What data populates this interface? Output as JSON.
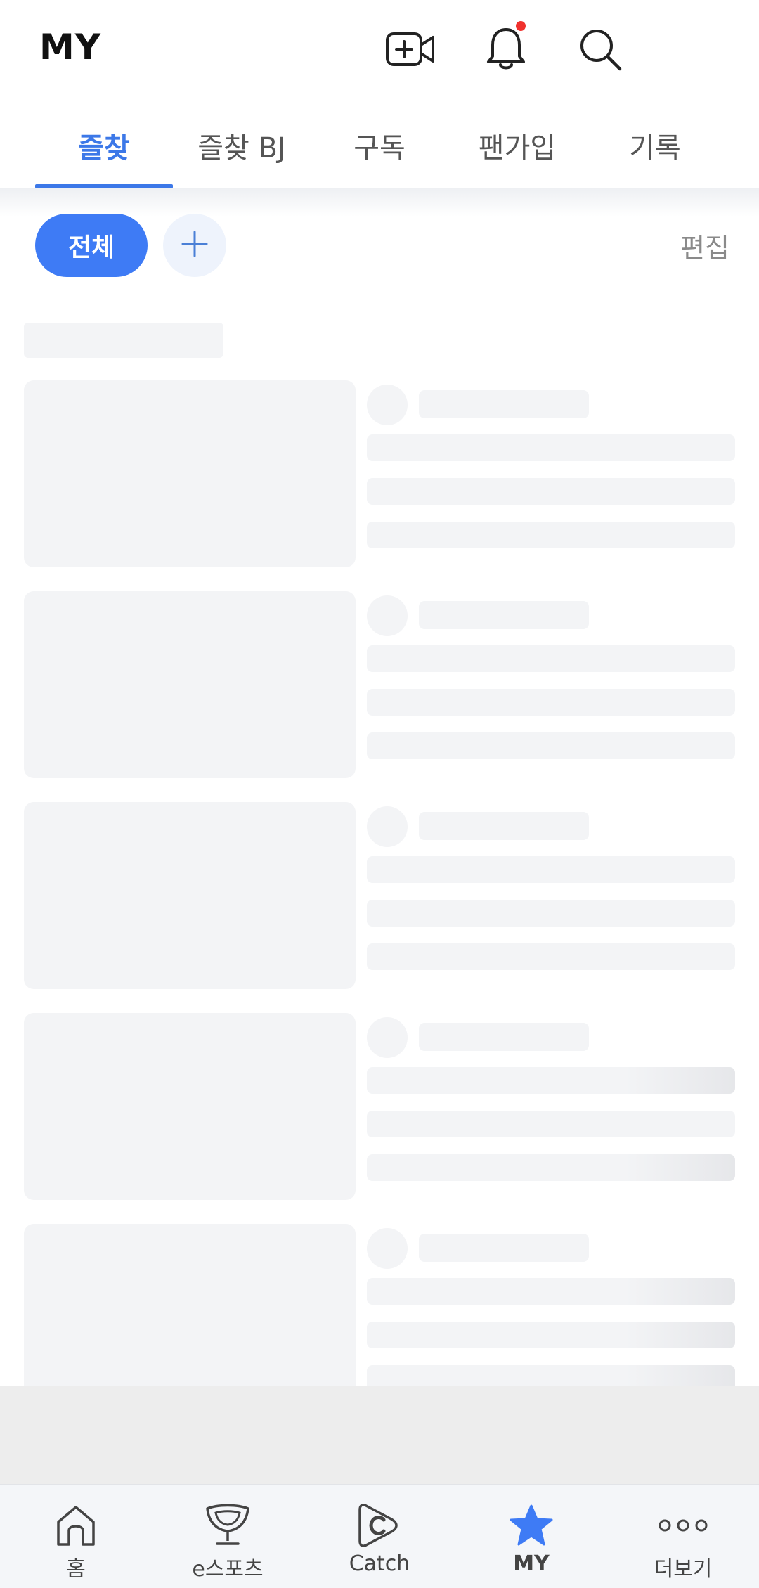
{
  "header": {
    "title": "MY",
    "icons": [
      "live-broadcast-icon",
      "bell-icon",
      "search-icon"
    ],
    "notification_dot_color": "#f0312d"
  },
  "tabs": [
    {
      "label": "즐찾",
      "active": true
    },
    {
      "label": "즐찾 BJ",
      "active": false
    },
    {
      "label": "구독",
      "active": false
    },
    {
      "label": "팬가입",
      "active": false
    },
    {
      "label": "기록",
      "active": false
    }
  ],
  "filter": {
    "all_label": "전체",
    "add_icon": "plus-icon",
    "edit_label": "편집"
  },
  "colors": {
    "accent": "#3c78e8",
    "chip": "#3e7bf5",
    "skeleton": "#f3f4f6"
  },
  "bottom_nav": [
    {
      "label": "홈",
      "icon": "home-icon",
      "active": false
    },
    {
      "label": "e스포츠",
      "icon": "trophy-icon",
      "active": false
    },
    {
      "label": "Catch",
      "icon": "catch-icon",
      "active": false
    },
    {
      "label": "MY",
      "icon": "star-icon",
      "active": true
    },
    {
      "label": "더보기",
      "icon": "more-icon",
      "active": false
    }
  ]
}
